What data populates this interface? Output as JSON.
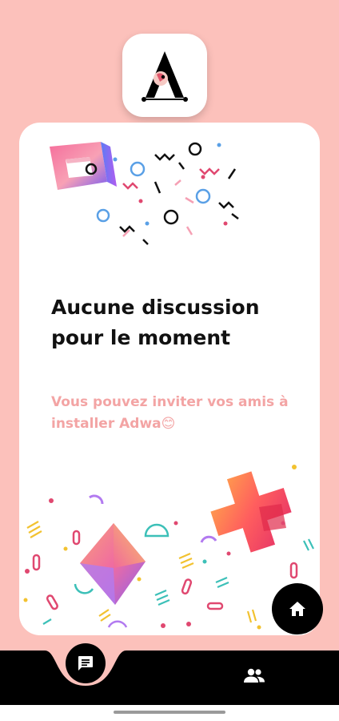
{
  "empty_state": {
    "title": "Aucune discussion pour le moment",
    "subtitle": "Vous pouvez inviter vos amis à installer Adwa😊"
  },
  "icons": {
    "logo": "adwa-a-logo-icon",
    "home": "home-icon",
    "chat": "chat-bubble-icon",
    "contacts": "people-icon"
  },
  "colors": {
    "background": "#fcc1bb",
    "card": "#ffffff",
    "title": "#111111",
    "subtitle": "#f3a4a4",
    "nav": "#000000"
  }
}
